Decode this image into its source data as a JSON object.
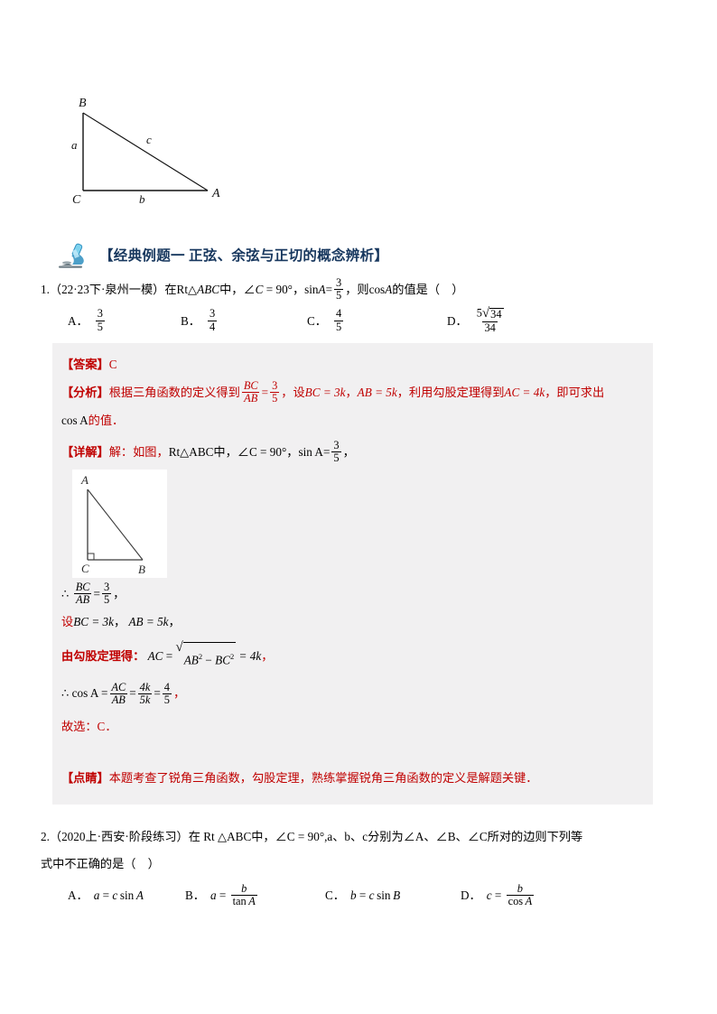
{
  "section": {
    "icon": "microscope-icon",
    "title": "【经典例题一 正弦、余弦与正切的概念辨析】",
    "title_color": "#17375E"
  },
  "figures": {
    "top": {
      "name": "right-triangle-abc-figure",
      "vertices": [
        "B",
        "C",
        "A"
      ],
      "sides": [
        "a",
        "c",
        "b"
      ]
    },
    "solution": {
      "name": "right-triangle-acb-figure",
      "vertices": [
        "A",
        "C",
        "B"
      ],
      "right_angle_at": "C"
    }
  },
  "questions": [
    {
      "number": "1.",
      "source": "（22·23下·泉州一模）",
      "stem_parts": {
        "p1": "在Rt△",
        "tri": "ABC",
        "p2": "中，∠",
        "c": "C",
        "p3": " = 90°，",
        "sin": "sin",
        "a": "A",
        "eq": "=",
        "frac_num": "3",
        "frac_den": "5",
        "p4": "，则",
        "cos": "cos",
        "a2": "A",
        "p5": "的值是（　）"
      },
      "options": [
        {
          "label": "A．",
          "num": "3",
          "den": "5"
        },
        {
          "label": "B．",
          "num": "3",
          "den": "4"
        },
        {
          "label": "C．",
          "num": "4",
          "den": "5"
        },
        {
          "label": "D．",
          "num": "5√34",
          "den": "34"
        }
      ]
    },
    {
      "number": "2.",
      "source": "（2020上·西安·阶段练习）",
      "stem_line1": "在 Rt △ABC中，∠C = 90°,a、b、c分别为∠A、∠B、∠C所对的边则下列等",
      "stem_line2": "式中不正确的是（　）",
      "options": [
        {
          "label": "A．",
          "text": "a = c sin A"
        },
        {
          "label": "B．",
          "text": "a = b / tan A"
        },
        {
          "label": "C．",
          "text": "b = c sin B"
        },
        {
          "label": "D．",
          "text": "c = b / cos A"
        }
      ]
    }
  ],
  "answer_block": {
    "answer_tag": "【答案】",
    "answer_value": "C",
    "analysis_tag": "【分析】",
    "analysis_t1": "根据三角函数的定义得到",
    "analysis_f1_num": "BC",
    "analysis_f1_den": "AB",
    "analysis_eq": "=",
    "analysis_f2_num": "3",
    "analysis_f2_den": "5",
    "analysis_t2": "，设",
    "analysis_bc": "BC = 3k",
    "analysis_t3": "，",
    "analysis_ab": "AB = 5k",
    "analysis_t4": "，利用勾股定理得到",
    "analysis_ac": "AC = 4k",
    "analysis_t5": "，即可求出",
    "analysis_line2_a": "cos A",
    "analysis_line2_b": "的值．",
    "detail_tag": "【详解】",
    "detail_t1": "解：如图，",
    "detail_t2": "Rt△ABC中，∠C = 90°，",
    "detail_sin": "sin A",
    "detail_eq": "=",
    "detail_num": "3",
    "detail_den": "5",
    "detail_comma": "，",
    "step1_pre": "∴",
    "step1_fnum": "BC",
    "step1_fden": "AB",
    "step1_eq": "=",
    "step1_num2": "3",
    "step1_den2": "5",
    "step1_end": "，",
    "step2_tag": "设",
    "step2_a": "BC = 3k",
    "step2_c1": "，",
    "step2_b": "AB = 5k",
    "step2_c2": "，",
    "step3_tag": "由勾股定理得：",
    "step3_lhs": "AC",
    "step3_eq": "=",
    "step3_rad": "AB² − BC²",
    "step3_rhs": "= 4k",
    "step3_end": "，",
    "step4_pre": "∴ cos A",
    "step4_eq": "=",
    "step4_f1num": "AC",
    "step4_f1den": "AB",
    "step4_eq2": "=",
    "step4_f2num": "4k",
    "step4_f2den": "5k",
    "step4_eq3": "=",
    "step4_f3num": "4",
    "step4_f3den": "5",
    "step4_end": "，",
    "choose": "故选：C．",
    "hint_tag": "【点睛】",
    "hint_text": "本题考查了锐角三角函数，勾股定理，熟练掌握锐角三角函数的定义是解题关键．"
  },
  "colors": {
    "red": "#c00000",
    "grey_bg": "#f1f0f1",
    "title_navy": "#17375E",
    "icon_blue": "#2E8FC0"
  }
}
